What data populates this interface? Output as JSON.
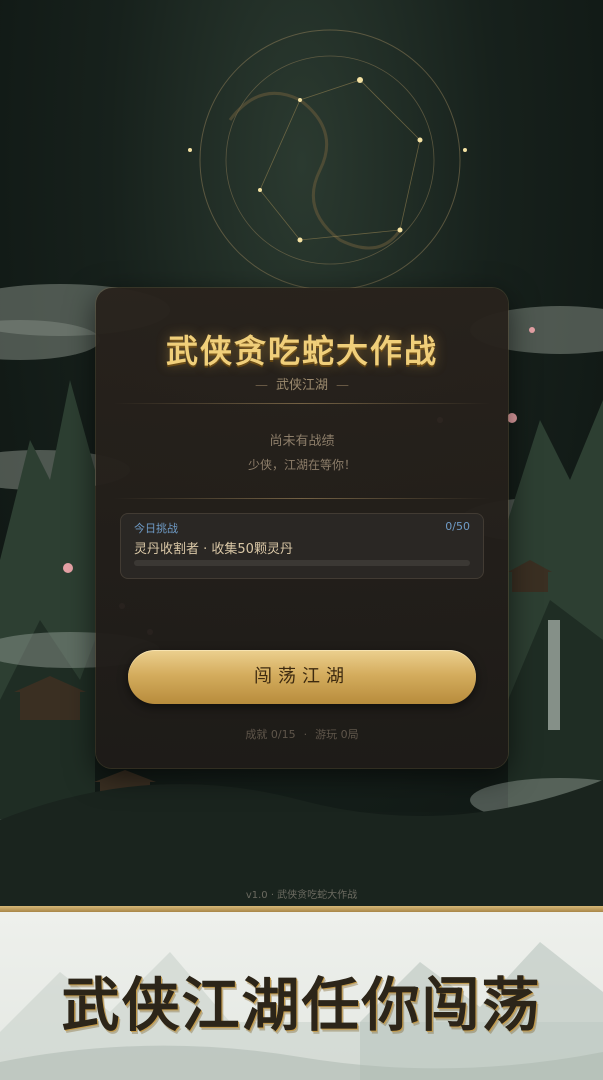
{
  "game": {
    "title": "武侠贪吃蛇大作战",
    "subtitle": "武侠江湖",
    "subtitle_dash": "—"
  },
  "record": {
    "empty_text": "尚未有战绩",
    "waiting_text": "少侠，江湖在等你！"
  },
  "daily_challenge": {
    "label": "今日挑战",
    "progress_text": "0/50",
    "progress_fraction": 0,
    "description": "灵丹收割者 · 收集50颗灵丹"
  },
  "start_button": {
    "label": "闯荡江湖"
  },
  "stats": {
    "achievements": "成就 0/15",
    "separator": "·",
    "plays": "游玩 0局"
  },
  "footer": {
    "version": "v1.0 · 武侠贪吃蛇大作战"
  },
  "banner": {
    "slogan": "武侠江湖任你闯荡"
  },
  "colors": {
    "title_gold": "#f0cf7a",
    "button_gold": "#d4ad5e",
    "challenge_blue": "#6f9bc6"
  }
}
